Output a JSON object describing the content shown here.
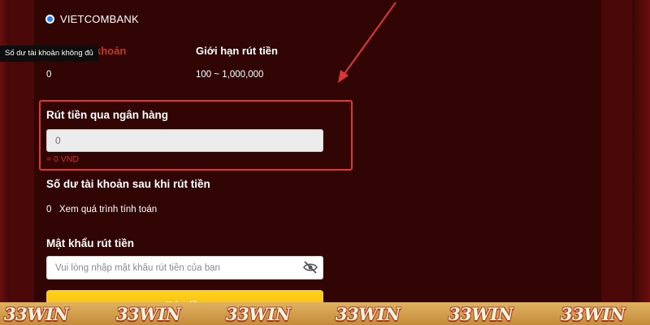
{
  "bank": {
    "name": "VIETCOMBANK",
    "selected": true
  },
  "tooltip": {
    "text": "Số dư tài khoản không đủ"
  },
  "account": {
    "balance_label": "Số dư tài khoản",
    "balance_value": "0",
    "limit_label": "Giới hạn rút tiền",
    "limit_value": "100 ~ 1,000,000"
  },
  "withdraw": {
    "label": "Rút tiền qua ngân hàng",
    "placeholder": "0",
    "equivalent": "= 0 VND"
  },
  "after_balance": {
    "label": "Số dư tài khoản sau khi rút tiền",
    "value": "0",
    "calc_link": "Xem quá trình tính toán"
  },
  "password": {
    "label": "Mật khẩu rút tiền",
    "placeholder": "Vui lòng nhập mật khẩu rút tiền của bạn",
    "visibility_icon": "eye-slash-icon"
  },
  "submit": {
    "label": "Rút tiền"
  },
  "watermark": {
    "text": "33WIN"
  },
  "colors": {
    "background": "#320505",
    "highlight": "#e0343b",
    "error": "#c0392b",
    "button": "#f5b400",
    "banner": "#d6a050"
  }
}
